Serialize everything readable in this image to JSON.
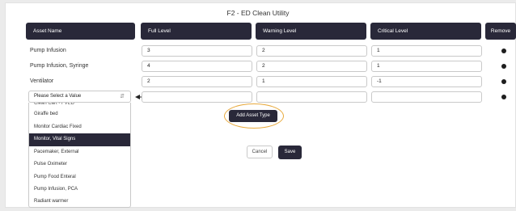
{
  "page": {
    "title": "F2 - ED Clean Utility"
  },
  "table": {
    "headers": {
      "asset_name": "Asset Name",
      "full_level": "Full Level",
      "warning_level": "Warning Level",
      "critical_level": "Critical Level",
      "remove": "Remove"
    },
    "rows": [
      {
        "name": "Pump Infusion",
        "full": "3",
        "warning": "2",
        "critical": "1"
      },
      {
        "name": "Pump Infusion, Syringe",
        "full": "4",
        "warning": "2",
        "critical": "1"
      },
      {
        "name": "Ventilator",
        "full": "2",
        "warning": "1",
        "critical": "-1"
      }
    ],
    "new_row": {
      "select_value": "Please Select a Value",
      "full": "",
      "warning": "",
      "critical": ""
    }
  },
  "dropdown": {
    "cut_top": "Clean Cart - FVED",
    "items": [
      "Giraffe bed",
      "Monitor Cardiac Fixed",
      "Monitor, Vital Signs",
      "Pacemaker, External",
      "Pulse Oximeter",
      "Pump Food Enteral",
      "Pump Infusion, PCA"
    ],
    "cut_bottom": "Radiant warmer",
    "selected_index": 2
  },
  "buttons": {
    "add_asset_type": "Add Asset Type",
    "cancel": "Cancel",
    "save": "Save"
  },
  "colors": {
    "header_bg": "#292839",
    "highlight_ring": "#e8a93c"
  },
  "icons": {
    "remove": "remove-dot-icon",
    "select_chevron": "updown-chevron-icon",
    "annotation_arrow": "left-arrow-icon"
  }
}
